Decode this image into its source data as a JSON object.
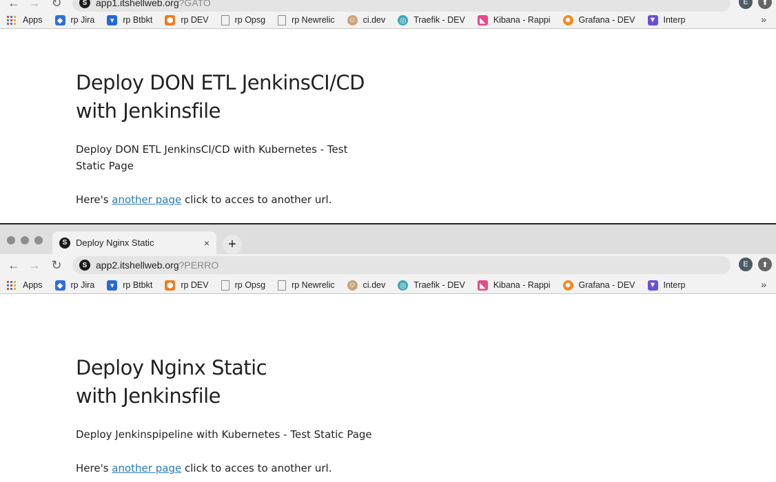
{
  "window1": {
    "address": {
      "host": "app1.itshellweb.org",
      "query": "?GATO"
    },
    "profile_initial": "E",
    "content": {
      "heading": "Deploy DON ETL JenkinsCI/CD with Jenkinsfile",
      "paragraph": "Deploy DON ETL JenkinsCI/CD with Kubernetes - Test Static Page",
      "link_prefix": "Here's",
      "link_text": "another page",
      "link_suffix": "click to acces to another url."
    }
  },
  "window2": {
    "tab": {
      "title": "Deploy Nginx Static",
      "favicon_letter": "S",
      "close": "×"
    },
    "new_tab": "+",
    "address": {
      "host": "app2.itshellweb.org",
      "query": "?PERRO"
    },
    "profile_initial": "E",
    "content": {
      "heading": "Deploy Nginx Static with Jenkinsfile",
      "paragraph": "Deploy Jenkinspipeline with Kubernetes - Test Static Page",
      "link_prefix": "Here's",
      "link_text": "another page",
      "link_suffix": "click to acces to another url."
    }
  },
  "site_favicon_letter": "S",
  "bookmarks": {
    "apps": "Apps",
    "items": [
      "rp Jira",
      "rp Btbkt",
      "rp DEV",
      "rp Opsg",
      "rp Newrelic",
      "ci.dev",
      "Traefik - DEV",
      "Kibana - Rappi",
      "Grafana - DEV",
      "Interp"
    ],
    "more": "»"
  },
  "colors": {
    "link": "#2a7ab8",
    "chrome_bg": "#f2f2f2",
    "tabstrip_bg": "#dedede"
  }
}
